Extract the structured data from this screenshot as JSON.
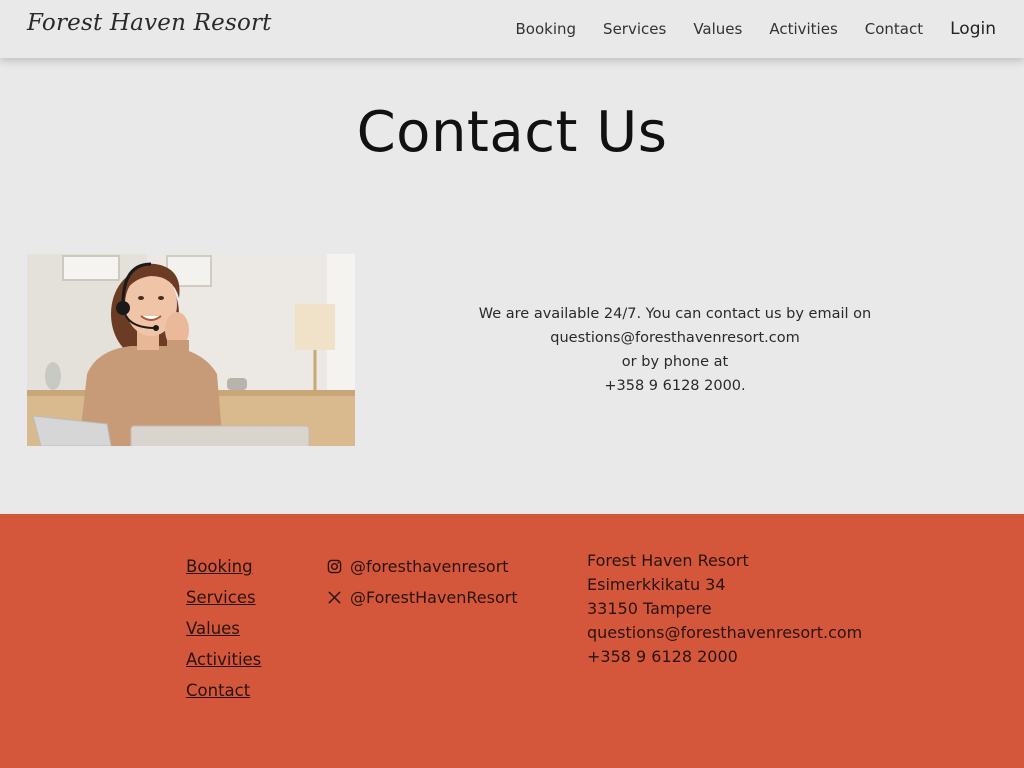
{
  "site": {
    "logo": "Forest Haven Resort"
  },
  "nav": {
    "items": [
      {
        "label": "Booking"
      },
      {
        "label": "Services"
      },
      {
        "label": "Values"
      },
      {
        "label": "Activities"
      },
      {
        "label": "Contact"
      }
    ],
    "login": "Login"
  },
  "main": {
    "title": "Contact Us",
    "contact_lines": [
      "We are available 24/7. You can contact us by email on",
      "questions@foresthavenresort.com",
      "or by phone at",
      "+358 9 6128 2000."
    ]
  },
  "footer": {
    "links": [
      {
        "label": "Booking"
      },
      {
        "label": "Services"
      },
      {
        "label": "Values"
      },
      {
        "label": "Activities"
      },
      {
        "label": "Contact"
      }
    ],
    "socials": [
      {
        "icon": "instagram-icon",
        "handle": "@foresthavenresort"
      },
      {
        "icon": "x-icon",
        "handle": "@ForestHavenResort"
      }
    ],
    "address": [
      "Forest Haven Resort",
      "Esimerkkikatu 34",
      "33150 Tampere",
      "questions@foresthavenresort.com",
      "+358 9 6128 2000"
    ]
  },
  "colors": {
    "background": "#e9e9e9",
    "footer": "#d5573b",
    "text": "#222222"
  }
}
